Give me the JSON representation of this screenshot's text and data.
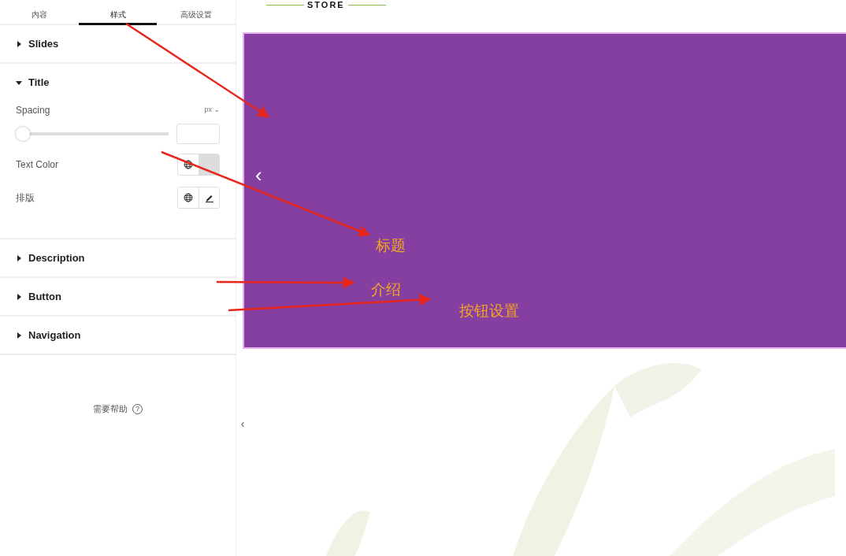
{
  "tabs": [
    {
      "label": "内容",
      "selected": false
    },
    {
      "label": "样式",
      "selected": true
    },
    {
      "label": "高级设置",
      "selected": false
    }
  ],
  "sections": [
    {
      "title": "Slides",
      "expanded": false
    },
    {
      "title": "Title",
      "expanded": true,
      "controls": [
        {
          "kind": "slider",
          "label": "Spacing",
          "unit": "px ⌄",
          "level": 0
        },
        {
          "kind": "color",
          "label": "Text Color"
        },
        {
          "kind": "typography",
          "label": "排版"
        }
      ]
    },
    {
      "title": "Description",
      "expanded": false
    },
    {
      "title": "Button",
      "expanded": false
    },
    {
      "title": "Navigation",
      "expanded": false
    }
  ],
  "help": {
    "label": "需要帮助",
    "icon": "?"
  },
  "panel_toggle": "‹",
  "logo": "STORE",
  "slide": {
    "prev": "‹"
  },
  "annotations": [
    {
      "label": "标题"
    },
    {
      "label": "介绍"
    },
    {
      "label": "按钮设置"
    }
  ]
}
